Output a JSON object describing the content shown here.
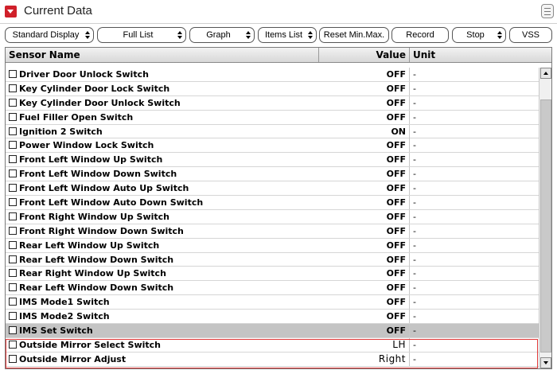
{
  "window": {
    "title": "Current Data"
  },
  "toolbar": {
    "display_mode": "Standard Display",
    "list_mode": "Full List",
    "view_mode": "Graph",
    "items_list": "Items List",
    "reset": "Reset Min.Max.",
    "record": "Record",
    "stop": "Stop",
    "vss": "VSS"
  },
  "table": {
    "headers": {
      "name": "Sensor Name",
      "value": "Value",
      "unit": "Unit"
    },
    "rows": [
      {
        "name": "Driver Door Unlock Switch",
        "value": "OFF",
        "unit": "-"
      },
      {
        "name": "Key Cylinder Door Lock Switch",
        "value": "OFF",
        "unit": "-"
      },
      {
        "name": "Key Cylinder Door Unlock Switch",
        "value": "OFF",
        "unit": "-"
      },
      {
        "name": "Fuel Filler Open Switch",
        "value": "OFF",
        "unit": "-"
      },
      {
        "name": "Ignition 2 Switch",
        "value": "ON",
        "unit": "-"
      },
      {
        "name": "Power Window Lock Switch",
        "value": "OFF",
        "unit": "-"
      },
      {
        "name": "Front Left Window Up Switch",
        "value": "OFF",
        "unit": "-"
      },
      {
        "name": "Front Left Window Down Switch",
        "value": "OFF",
        "unit": "-"
      },
      {
        "name": "Front Left Window Auto Up Switch",
        "value": "OFF",
        "unit": "-"
      },
      {
        "name": "Front Left Window Auto Down Switch",
        "value": "OFF",
        "unit": "-"
      },
      {
        "name": "Front Right Window Up Switch",
        "value": "OFF",
        "unit": "-"
      },
      {
        "name": "Front Right Window Down Switch",
        "value": "OFF",
        "unit": "-"
      },
      {
        "name": "Rear Left Window Up Switch",
        "value": "OFF",
        "unit": "-"
      },
      {
        "name": "Rear Left Window Down Switch",
        "value": "OFF",
        "unit": "-"
      },
      {
        "name": "Rear Right Window Up Switch",
        "value": "OFF",
        "unit": "-"
      },
      {
        "name": "Rear Left Window Down Switch",
        "value": "OFF",
        "unit": "-"
      },
      {
        "name": "IMS Mode1 Switch",
        "value": "OFF",
        "unit": "-"
      },
      {
        "name": "IMS Mode2 Switch",
        "value": "OFF",
        "unit": "-"
      },
      {
        "name": "IMS Set Switch",
        "value": "OFF",
        "unit": "-"
      },
      {
        "name": "Outside Mirror Select Switch",
        "value": "LH",
        "unit": "-"
      },
      {
        "name": "Outside Mirror Adjust",
        "value": "Right",
        "unit": "-"
      }
    ]
  },
  "colors": {
    "highlight": "#e03a3a",
    "title_toggle": "#d0202a",
    "selected_row": "#c4c4c4"
  }
}
